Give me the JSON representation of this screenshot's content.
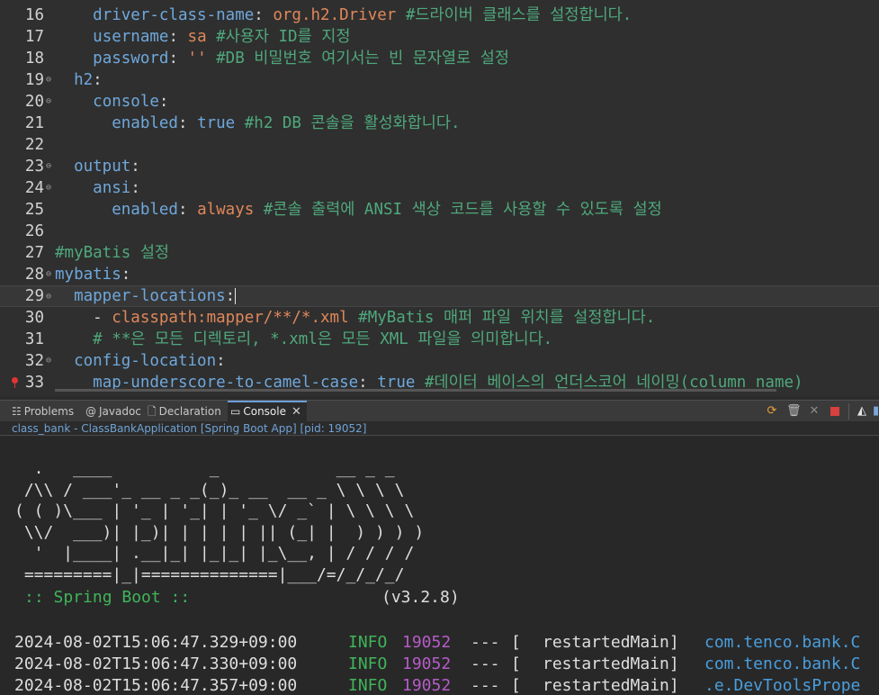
{
  "editor": {
    "lines": [
      {
        "n": "16",
        "segments": [
          {
            "t": "    ",
            "c": "p"
          },
          {
            "t": "driver-class-name",
            "c": "k"
          },
          {
            "t": ": ",
            "c": "p"
          },
          {
            "t": "org.h2.Driver",
            "c": "v"
          },
          {
            "t": " #드라이버 클래스를 설정합니다.",
            "c": "c"
          }
        ]
      },
      {
        "n": "17",
        "segments": [
          {
            "t": "    ",
            "c": "p"
          },
          {
            "t": "username",
            "c": "k"
          },
          {
            "t": ": ",
            "c": "p"
          },
          {
            "t": "sa",
            "c": "v"
          },
          {
            "t": " #사용자 ID를 지정",
            "c": "c"
          }
        ]
      },
      {
        "n": "18",
        "segments": [
          {
            "t": "    ",
            "c": "p"
          },
          {
            "t": "password",
            "c": "k"
          },
          {
            "t": ": ",
            "c": "p"
          },
          {
            "t": "''",
            "c": "v"
          },
          {
            "t": " #DB 비밀번호 여기서는 빈 문자열로 설정",
            "c": "c"
          }
        ]
      },
      {
        "n": "19",
        "fold": true,
        "segments": [
          {
            "t": "  ",
            "c": "p"
          },
          {
            "t": "h2",
            "c": "k"
          },
          {
            "t": ":",
            "c": "p"
          }
        ]
      },
      {
        "n": "20",
        "fold": true,
        "segments": [
          {
            "t": "    ",
            "c": "p"
          },
          {
            "t": "console",
            "c": "k"
          },
          {
            "t": ":",
            "c": "p"
          }
        ]
      },
      {
        "n": "21",
        "segments": [
          {
            "t": "      ",
            "c": "p"
          },
          {
            "t": "enabled",
            "c": "k"
          },
          {
            "t": ": ",
            "c": "p"
          },
          {
            "t": "true",
            "c": "kw"
          },
          {
            "t": " #h2 DB 콘솔을 활성화합니다.",
            "c": "c"
          }
        ]
      },
      {
        "n": "22",
        "segments": []
      },
      {
        "n": "23",
        "fold": true,
        "segments": [
          {
            "t": "  ",
            "c": "p"
          },
          {
            "t": "output",
            "c": "k"
          },
          {
            "t": ":",
            "c": "p"
          }
        ]
      },
      {
        "n": "24",
        "fold": true,
        "segments": [
          {
            "t": "    ",
            "c": "p"
          },
          {
            "t": "ansi",
            "c": "k"
          },
          {
            "t": ":",
            "c": "p"
          }
        ]
      },
      {
        "n": "25",
        "segments": [
          {
            "t": "      ",
            "c": "p"
          },
          {
            "t": "enabled",
            "c": "k"
          },
          {
            "t": ": ",
            "c": "p"
          },
          {
            "t": "always",
            "c": "v"
          },
          {
            "t": " #콘솔 출력에 ANSI 색상 코드를 사용할 수 있도록 설정",
            "c": "c"
          }
        ]
      },
      {
        "n": "26",
        "segments": []
      },
      {
        "n": "27",
        "segments": [
          {
            "t": "#myBatis 설정",
            "c": "c"
          }
        ]
      },
      {
        "n": "28",
        "fold": true,
        "segments": [
          {
            "t": "mybatis",
            "c": "k"
          },
          {
            "t": ":",
            "c": "p"
          }
        ]
      },
      {
        "n": "29",
        "fold": true,
        "current": true,
        "segments": [
          {
            "t": "  ",
            "c": "p"
          },
          {
            "t": "mapper-locations",
            "c": "k"
          },
          {
            "t": ":",
            "c": "p"
          }
        ]
      },
      {
        "n": "30",
        "segments": [
          {
            "t": "    - ",
            "c": "p"
          },
          {
            "t": "classpath:mapper/**/*.xml",
            "c": "v"
          },
          {
            "t": " #MyBatis 매퍼 파일 위치를 설정합니다.",
            "c": "c"
          }
        ]
      },
      {
        "n": "31",
        "segments": [
          {
            "t": "    ",
            "c": "p"
          },
          {
            "t": "# **은 모든 디렉토리, *.xml은 모든 XML 파일을 의미합니다.",
            "c": "c"
          }
        ]
      },
      {
        "n": "32",
        "fold": true,
        "segments": [
          {
            "t": "  ",
            "c": "p"
          },
          {
            "t": "config-location",
            "c": "k"
          },
          {
            "t": ":",
            "c": "p"
          }
        ]
      },
      {
        "n": "33",
        "marker": true,
        "segments": [
          {
            "t": "    ",
            "c": "p"
          },
          {
            "t": "map-underscore-to-camel-case",
            "c": "k"
          },
          {
            "t": ": ",
            "c": "p"
          },
          {
            "t": "true",
            "c": "kw"
          },
          {
            "t": " #데이터 베이스의 언더스코어 네이밍(column_name)",
            "c": "c"
          }
        ]
      }
    ]
  },
  "view": {
    "tabs": [
      {
        "name": "tab-problems",
        "icon": "problems-icon",
        "glyph": "☷",
        "label": "Problems"
      },
      {
        "name": "tab-javadoc",
        "icon": "javadoc-icon",
        "glyph": "@",
        "label": "Javadoc"
      },
      {
        "name": "tab-declaration",
        "icon": "declaration-icon",
        "glyph": "🗋",
        "label": "Declaration"
      },
      {
        "name": "tab-console",
        "icon": "console-icon",
        "glyph": "▭",
        "label": "Console",
        "active": true
      }
    ],
    "console_title": "class_bank - ClassBankApplication [Spring Boot App]  [pid: 19052]"
  },
  "console": {
    "banner": [
      "  .   ____          _            __ _ _",
      " /\\\\ / ___'_ __ _ _(_)_ __  __ _ \\ \\ \\ \\",
      "( ( )\\___ | '_ | '_| | '_ \\/ _` | \\ \\ \\ \\",
      " \\\\/  ___)| |_)| | | | | || (_| |  ) ) ) )",
      "  '  |____| .__|_| |_|_| |_\\__, | / / / /",
      " =========|_|==============|___/=/_/_/_/"
    ],
    "boot_label": ":: Spring Boot ::",
    "boot_version": "(v3.2.8)",
    "logs": [
      {
        "ts": "2024-08-02T15:06:47.329+09:00",
        "level": "INFO",
        "pid": "19052",
        "dash": "---",
        "bracket": "[",
        "thread": "restartedMain]",
        "logger": "com.tenco.bank.C"
      },
      {
        "ts": "2024-08-02T15:06:47.330+09:00",
        "level": "INFO",
        "pid": "19052",
        "dash": "---",
        "bracket": "[",
        "thread": "restartedMain]",
        "logger": "com.tenco.bank.C"
      },
      {
        "ts": "2024-08-02T15:06:47.357+09:00",
        "level": "INFO",
        "pid": "19052",
        "dash": "---",
        "bracket": "[",
        "thread": "restartedMain]",
        "logger": ".e.DevToolsPrope"
      }
    ]
  }
}
